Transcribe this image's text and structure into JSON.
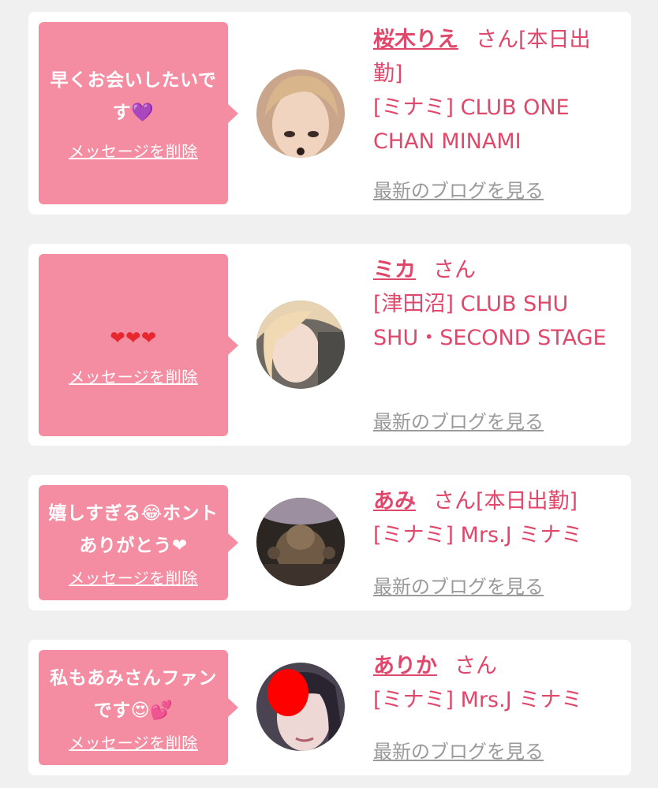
{
  "cards": [
    {
      "message": "早くお会いしたいです💜",
      "delete_label": "メッセージを削除",
      "name": "桜木りえ",
      "suffix": "さん[本日出勤]",
      "shop": "[ミナミ] CLUB ONE CHAN MINAMI",
      "blog_label": "最新のブログを見る"
    },
    {
      "message": "❤❤❤",
      "delete_label": "メッセージを削除",
      "name": "ミカ",
      "suffix": "さん",
      "shop": "[津田沼] CLUB SHU SHU・SECOND STAGE",
      "blog_label": "最新のブログを見る"
    },
    {
      "message": "嬉しすぎる😂ホントありがとう❤",
      "delete_label": "メッセージを削除",
      "name": "あみ",
      "suffix": "さん[本日出勤]",
      "shop": "[ミナミ] Mrs.J ミナミ",
      "blog_label": "最新のブログを見る"
    },
    {
      "message": "私もあみさんファンです😍💕",
      "delete_label": "メッセージを削除",
      "name": "ありか",
      "suffix": "さん",
      "shop": "[ミナミ] Mrs.J ミナミ",
      "blog_label": "最新のブログを見る"
    }
  ],
  "colors": {
    "background": "#f0f0f0",
    "card": "#ffffff",
    "bubble": "#f58da2",
    "accent": "#e0476a",
    "muted": "#9a9a9a"
  }
}
